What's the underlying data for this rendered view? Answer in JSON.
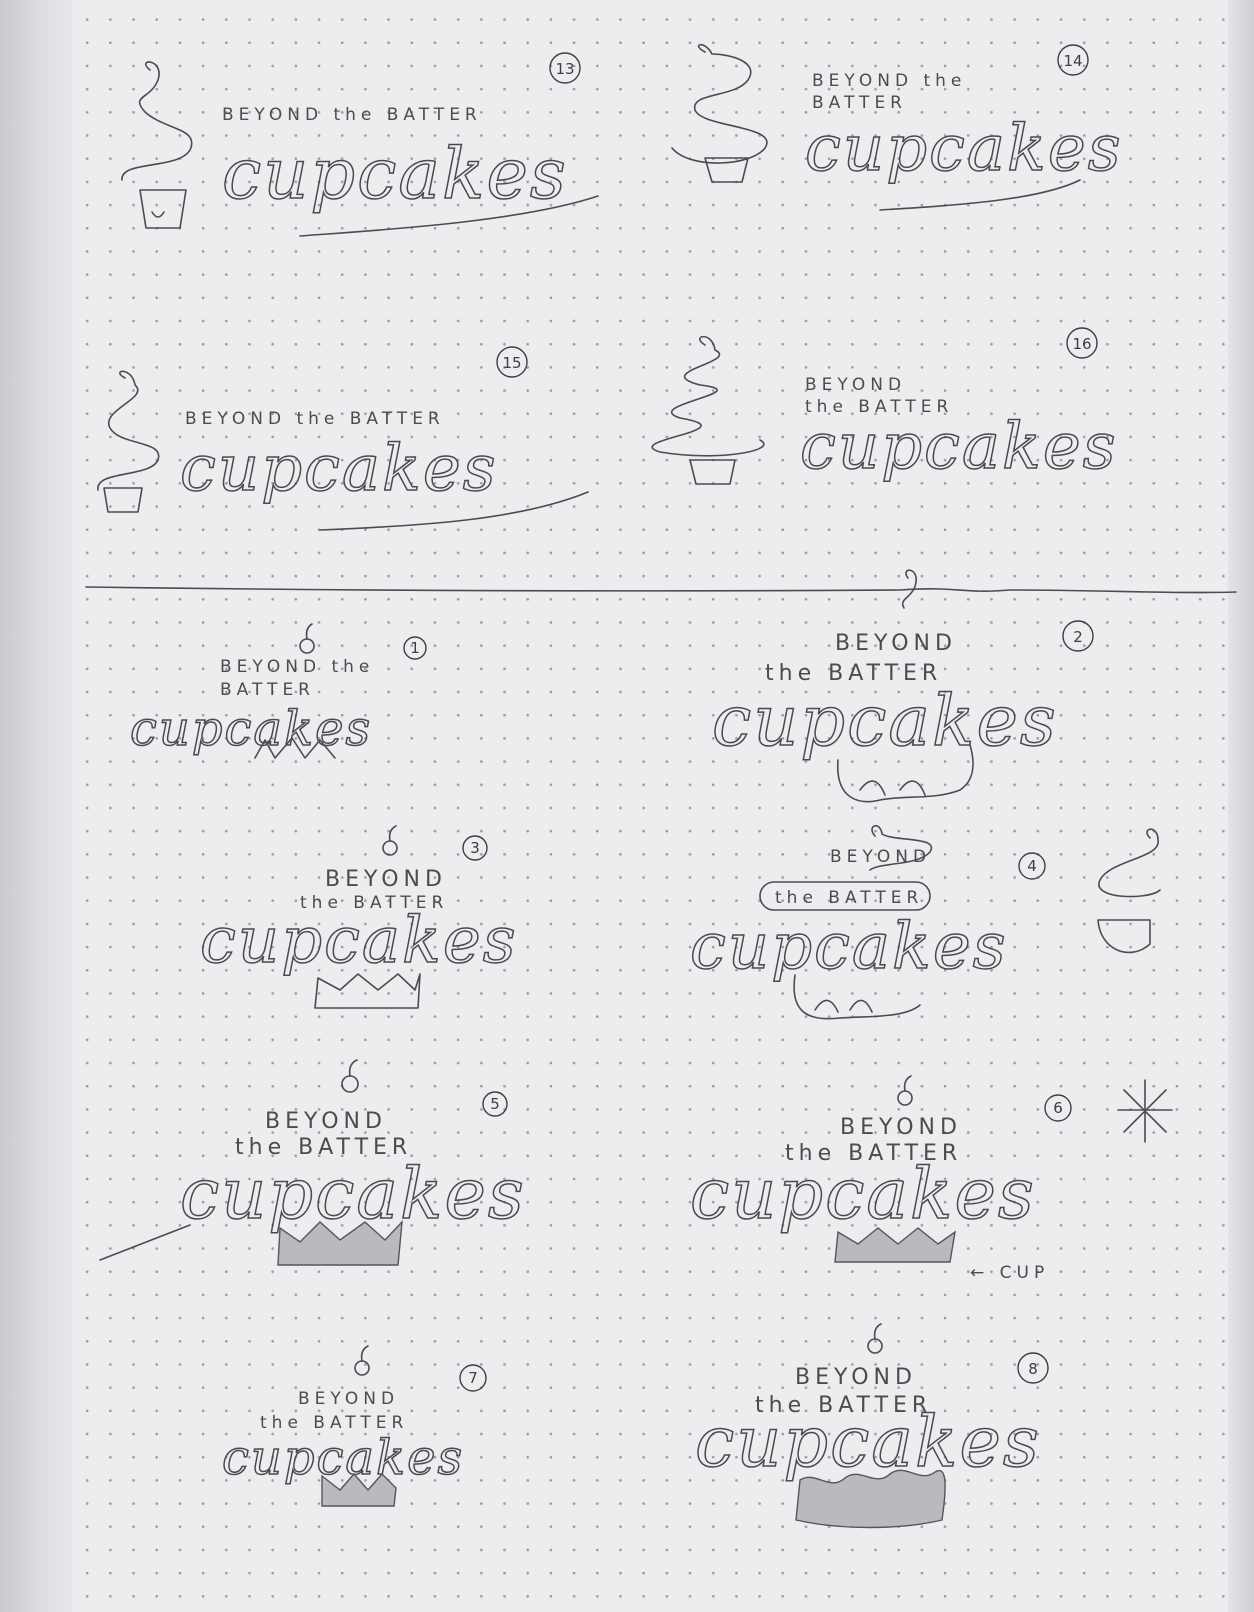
{
  "concepts": [
    {
      "id": "13",
      "beyond": "BEYOND the BATTER",
      "batter": "",
      "word": "cupcakes"
    },
    {
      "id": "14",
      "beyond": "BEYOND the",
      "batter": "BATTER",
      "word": "cupcakes"
    },
    {
      "id": "15",
      "beyond": "BEYOND the BATTER",
      "batter": "",
      "word": "cupcakes"
    },
    {
      "id": "16",
      "beyond": "BEYOND",
      "batter": "the BATTER",
      "word": "cupcakes"
    },
    {
      "id": "1",
      "beyond": "BEYOND the",
      "batter": "BATTER",
      "word": "cupcakes"
    },
    {
      "id": "2",
      "beyond": "BEYOND",
      "batter": "the BATTER",
      "word": "cupcakes"
    },
    {
      "id": "3",
      "beyond": "BEYOND",
      "batter": "the BATTER",
      "word": "cupcakes"
    },
    {
      "id": "4",
      "beyond": "BEYOND",
      "batter": "the BATTER",
      "word": "cupcakes"
    },
    {
      "id": "5",
      "beyond": "BEYOND",
      "batter": "the BATTER",
      "word": "cupcakes"
    },
    {
      "id": "6",
      "beyond": "BEYOND",
      "batter": "the BATTER",
      "word": "cupcakes"
    },
    {
      "id": "7",
      "beyond": "BEYOND",
      "batter": "the BATTER",
      "word": "cupcakes"
    },
    {
      "id": "8",
      "beyond": "BEYOND",
      "batter": "the BATTER",
      "word": "cupcakes"
    }
  ],
  "cup_note": "← CUP",
  "colors": {
    "paper": "#ecedef",
    "pencil": "#4c4c4f",
    "dot": "#9a9ea6"
  }
}
